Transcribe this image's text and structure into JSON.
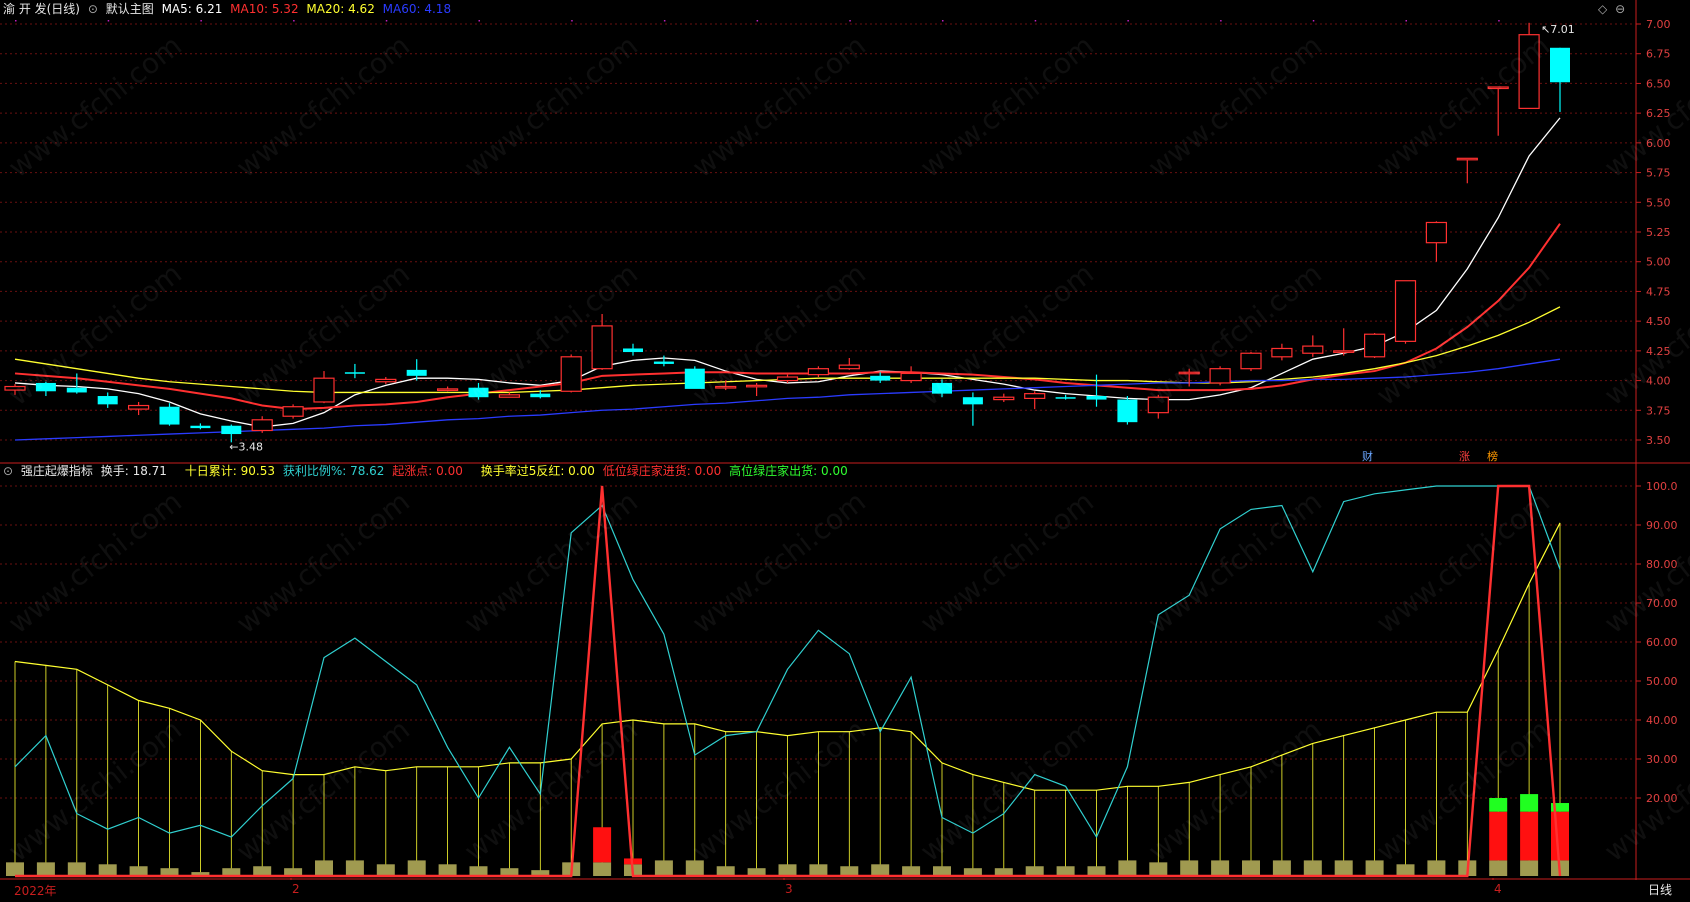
{
  "main_header": {
    "stock_name": "渝 开 发(日线)",
    "template": "默认主图",
    "ma": [
      {
        "label": "MA5: 6.21",
        "color": "#ffffff"
      },
      {
        "label": "MA10: 5.32",
        "color": "#ff3030"
      },
      {
        "label": "MA20: 4.62",
        "color": "#ffff30"
      },
      {
        "label": "MA60: 4.18",
        "color": "#2a3bff"
      }
    ]
  },
  "sub_header": {
    "indicator": "强庄起爆指标",
    "items": [
      {
        "label": "换手: 18.71",
        "color": "#e8e8e8"
      },
      {
        "label": "十日累计: 90.53",
        "color": "#ffff30"
      },
      {
        "label": "获利比例%: 78.62",
        "color": "#30d0d0"
      },
      {
        "label": "起涨点: 0.00",
        "color": "#ff3030"
      },
      {
        "label": "换手率过5反红: 0.00",
        "color": "#ffff30"
      },
      {
        "label": "低位绿庄家进货: 0.00",
        "color": "#ff3030"
      },
      {
        "label": "高位绿庄家出货: 0.00",
        "color": "#30ff30"
      }
    ]
  },
  "bottom_bar": {
    "dates": [
      "2022年",
      "2",
      "3",
      "4"
    ],
    "period": "日线"
  },
  "markers": {
    "cai": "财",
    "zhang": "涨",
    "bang": "榜"
  },
  "annotations": {
    "high": "7.01",
    "low": "3.48"
  },
  "watermark": "www.cfchi.com",
  "colors": {
    "up": "#ff3030",
    "down": "#00ffff",
    "grid": "#6a1010",
    "axis": "#c81e1e"
  },
  "chart_data": [
    {
      "type": "candlestick",
      "title": "",
      "ylim": [
        3.4,
        7.05
      ],
      "y_ticks": [
        "7.00",
        "6.75",
        "6.50",
        "6.25",
        "6.00",
        "5.75",
        "5.50",
        "5.25",
        "5.00",
        "4.75",
        "4.50",
        "4.25",
        "4.00",
        "3.75",
        "3.50"
      ],
      "ohlc": [
        [
          3.92,
          3.97,
          3.88,
          3.95
        ],
        [
          3.98,
          3.99,
          3.87,
          3.91
        ],
        [
          3.94,
          4.06,
          3.89,
          3.9
        ],
        [
          3.87,
          3.9,
          3.77,
          3.8
        ],
        [
          3.76,
          3.82,
          3.71,
          3.79
        ],
        [
          3.78,
          3.81,
          3.62,
          3.63
        ],
        [
          3.62,
          3.64,
          3.59,
          3.6
        ],
        [
          3.62,
          3.63,
          3.48,
          3.55
        ],
        [
          3.58,
          3.7,
          3.56,
          3.67
        ],
        [
          3.7,
          3.8,
          3.68,
          3.78
        ],
        [
          3.82,
          4.08,
          3.81,
          4.02
        ],
        [
          4.07,
          4.14,
          4.02,
          4.06
        ],
        [
          3.99,
          4.03,
          3.97,
          4.01
        ],
        [
          4.09,
          4.18,
          4.0,
          4.04
        ],
        [
          3.93,
          3.95,
          3.91,
          3.93
        ],
        [
          3.94,
          3.98,
          3.84,
          3.86
        ],
        [
          3.86,
          3.9,
          3.86,
          3.88
        ],
        [
          3.89,
          3.92,
          3.85,
          3.86
        ],
        [
          3.91,
          4.22,
          3.9,
          4.2
        ],
        [
          4.1,
          4.56,
          4.09,
          4.46
        ],
        [
          4.27,
          4.31,
          4.21,
          4.24
        ],
        [
          4.16,
          4.21,
          4.12,
          4.14
        ],
        [
          4.1,
          4.12,
          3.98,
          3.93
        ],
        [
          3.95,
          4.0,
          3.92,
          3.95
        ],
        [
          3.95,
          3.98,
          3.87,
          3.96
        ],
        [
          4.0,
          4.05,
          3.98,
          4.03
        ],
        [
          4.05,
          4.12,
          4.03,
          4.1
        ],
        [
          4.1,
          4.19,
          4.09,
          4.13
        ],
        [
          4.04,
          4.07,
          3.98,
          4.0
        ],
        [
          4.0,
          4.12,
          3.98,
          4.06
        ],
        [
          3.98,
          4.01,
          3.86,
          3.89
        ],
        [
          3.86,
          3.9,
          3.62,
          3.8
        ],
        [
          3.84,
          3.89,
          3.82,
          3.86
        ],
        [
          3.85,
          3.91,
          3.76,
          3.89
        ],
        [
          3.86,
          3.88,
          3.84,
          3.85
        ],
        [
          3.87,
          4.05,
          3.78,
          3.84
        ],
        [
          3.84,
          3.87,
          3.63,
          3.65
        ],
        [
          3.73,
          3.88,
          3.68,
          3.86
        ],
        [
          4.06,
          4.1,
          3.95,
          4.07
        ],
        [
          3.98,
          4.12,
          3.96,
          4.1
        ],
        [
          4.1,
          4.24,
          4.08,
          4.23
        ],
        [
          4.2,
          4.31,
          4.17,
          4.27
        ],
        [
          4.23,
          4.38,
          4.2,
          4.29
        ],
        [
          4.24,
          4.44,
          4.21,
          4.25
        ],
        [
          4.2,
          4.4,
          4.19,
          4.39
        ],
        [
          4.33,
          4.84,
          4.31,
          4.84
        ],
        [
          5.16,
          5.34,
          5.0,
          5.33
        ],
        [
          5.87,
          5.87,
          5.66,
          5.87
        ],
        [
          6.47,
          6.47,
          6.06,
          6.47
        ],
        [
          6.29,
          7.01,
          6.29,
          6.91
        ],
        [
          6.8,
          6.8,
          6.26,
          6.51
        ]
      ],
      "series": [
        {
          "name": "MA5",
          "color": "#ffffff",
          "values": [
            3.98,
            3.96,
            3.95,
            3.93,
            3.89,
            3.82,
            3.72,
            3.66,
            3.61,
            3.64,
            3.73,
            3.88,
            3.96,
            4.02,
            4.02,
            4.01,
            3.98,
            3.96,
            4.0,
            4.12,
            4.17,
            4.19,
            4.17,
            4.08,
            4.01,
            3.98,
            3.99,
            4.04,
            4.08,
            4.07,
            4.05,
            4.01,
            3.97,
            3.92,
            3.89,
            3.87,
            3.85,
            3.84,
            3.84,
            3.88,
            3.94,
            4.06,
            4.18,
            4.23,
            4.29,
            4.41,
            4.59,
            4.94,
            5.37,
            5.89,
            6.21
          ]
        },
        {
          "name": "MA10",
          "color": "#ff3030",
          "values": [
            4.06,
            4.04,
            4.02,
            3.99,
            3.96,
            3.93,
            3.89,
            3.85,
            3.79,
            3.76,
            3.77,
            3.79,
            3.8,
            3.82,
            3.86,
            3.89,
            3.92,
            3.95,
            3.98,
            4.04,
            4.05,
            4.06,
            4.07,
            4.07,
            4.06,
            4.06,
            4.06,
            4.06,
            4.07,
            4.07,
            4.06,
            4.05,
            4.03,
            4.01,
            3.98,
            3.96,
            3.94,
            3.92,
            3.92,
            3.92,
            3.93,
            3.96,
            4.01,
            4.05,
            4.08,
            4.15,
            4.27,
            4.45,
            4.67,
            4.95,
            5.32
          ]
        },
        {
          "name": "MA20",
          "color": "#ffff30",
          "values": [
            4.18,
            4.14,
            4.1,
            4.06,
            4.02,
            3.99,
            3.97,
            3.95,
            3.93,
            3.91,
            3.9,
            3.9,
            3.9,
            3.9,
            3.9,
            3.9,
            3.9,
            3.91,
            3.92,
            3.94,
            3.96,
            3.97,
            3.98,
            3.99,
            4.0,
            4.01,
            4.02,
            4.02,
            4.02,
            4.02,
            4.02,
            4.02,
            4.02,
            4.02,
            4.01,
            4.0,
            4.0,
            3.99,
            3.98,
            3.98,
            3.99,
            4.01,
            4.03,
            4.06,
            4.1,
            4.15,
            4.21,
            4.29,
            4.38,
            4.49,
            4.62
          ]
        },
        {
          "name": "MA60",
          "color": "#2a3bff",
          "values": [
            3.5,
            3.51,
            3.52,
            3.53,
            3.54,
            3.55,
            3.56,
            3.57,
            3.58,
            3.59,
            3.6,
            3.62,
            3.63,
            3.65,
            3.67,
            3.68,
            3.7,
            3.71,
            3.73,
            3.75,
            3.76,
            3.78,
            3.8,
            3.81,
            3.83,
            3.85,
            3.86,
            3.88,
            3.89,
            3.9,
            3.91,
            3.92,
            3.93,
            3.94,
            3.95,
            3.96,
            3.97,
            3.98,
            3.98,
            3.99,
            4.0,
            4.0,
            4.01,
            4.01,
            4.02,
            4.03,
            4.05,
            4.07,
            4.1,
            4.14,
            4.18
          ]
        }
      ]
    },
    {
      "type": "line",
      "title": "",
      "ylim": [
        0,
        102
      ],
      "y_ticks": [
        "100.0",
        "90.00",
        "80.00",
        "70.00",
        "60.00",
        "50.00",
        "40.00",
        "30.00",
        "20.00"
      ],
      "series": [
        {
          "name": "十日累计",
          "color": "#ffff30",
          "values": [
            55,
            54,
            53,
            49,
            45,
            43,
            40,
            32,
            27,
            26,
            26,
            28,
            27,
            28,
            28,
            28,
            29,
            29,
            30,
            39,
            40,
            39,
            39,
            37,
            37,
            36,
            37,
            37,
            38,
            37,
            29,
            26,
            24,
            22,
            22,
            22,
            23,
            23,
            24,
            26,
            28,
            31,
            34,
            36,
            38,
            40,
            42,
            42,
            58,
            75,
            90.53
          ]
        },
        {
          "name": "获利比例%",
          "color": "#30d0d0",
          "values": [
            28,
            36,
            16,
            12,
            15,
            11,
            13,
            10,
            18,
            25,
            56,
            61,
            55,
            49,
            33,
            20,
            33,
            21,
            88,
            95,
            76,
            62,
            31,
            36,
            37,
            53,
            63,
            57,
            37,
            51,
            15,
            11,
            16,
            26,
            23,
            10,
            28,
            67,
            72,
            89,
            94,
            95,
            78,
            96,
            98,
            99,
            100,
            100,
            100,
            100,
            78.62
          ]
        },
        {
          "name": "起涨点",
          "color": "#ff3030",
          "values": [
            0,
            0,
            0,
            0,
            0,
            0,
            0,
            0,
            0,
            0,
            0,
            0,
            0,
            0,
            0,
            0,
            0,
            0,
            0,
            100,
            0,
            0,
            0,
            0,
            0,
            0,
            0,
            0,
            0,
            0,
            0,
            0,
            0,
            0,
            0,
            0,
            0,
            0,
            0,
            0,
            0,
            0,
            0,
            0,
            0,
            0,
            0,
            0,
            100,
            100,
            0
          ]
        }
      ],
      "bars_turnover": [
        3.5,
        3.5,
        3.5,
        3.0,
        2.5,
        2.0,
        1.0,
        2.0,
        2.5,
        2.0,
        4.5,
        4.5,
        3.0,
        4.0,
        3.0,
        2.5,
        2.0,
        1.5,
        3.5,
        3.5,
        3.0,
        4.0,
        4.0,
        2.5,
        2.0,
        3.0,
        3.0,
        2.5,
        3.0,
        2.5,
        2.5,
        2.0,
        2.0,
        2.5,
        2.5,
        2.5,
        4.0,
        3.5,
        4.5,
        5.0,
        4.0,
        4.0,
        4.0,
        4.5,
        5.0,
        3.0,
        4.5,
        16.5,
        17.0,
        16.5,
        18.71
      ],
      "bars_red_extra": [
        0,
        0,
        0,
        0,
        0,
        0,
        0,
        0,
        0,
        0,
        0,
        0,
        0,
        0,
        0,
        0,
        0,
        0,
        0,
        9,
        1.5,
        0,
        0,
        0,
        0,
        0,
        0,
        0,
        0,
        0,
        0,
        0,
        0,
        0,
        0,
        0,
        0,
        0,
        0,
        0,
        0,
        0,
        0,
        0,
        0,
        0,
        0,
        0,
        0,
        0,
        0
      ],
      "bars_red_top": [
        0,
        0,
        0,
        0,
        0,
        0,
        0,
        0,
        0,
        0,
        0,
        0,
        0,
        0,
        0,
        0,
        0,
        0,
        0,
        0,
        0,
        0,
        0,
        0,
        0,
        0,
        0,
        0,
        0,
        0,
        0,
        0,
        0,
        0,
        0,
        0,
        0,
        0,
        0,
        0,
        0,
        0,
        0,
        0,
        0,
        0,
        0,
        0,
        4,
        4,
        4
      ],
      "bars_green_top": [
        0,
        0,
        0,
        0,
        0,
        0,
        0,
        0,
        0,
        0,
        0,
        0,
        0,
        0,
        0,
        0,
        0,
        0,
        0,
        0,
        0,
        0,
        0,
        0,
        0,
        0,
        0,
        0,
        0,
        0,
        0,
        0,
        0,
        0,
        0,
        0,
        0,
        0,
        0,
        0,
        0,
        0,
        0,
        0,
        0,
        0,
        0,
        0,
        20,
        21,
        18.71
      ]
    }
  ]
}
